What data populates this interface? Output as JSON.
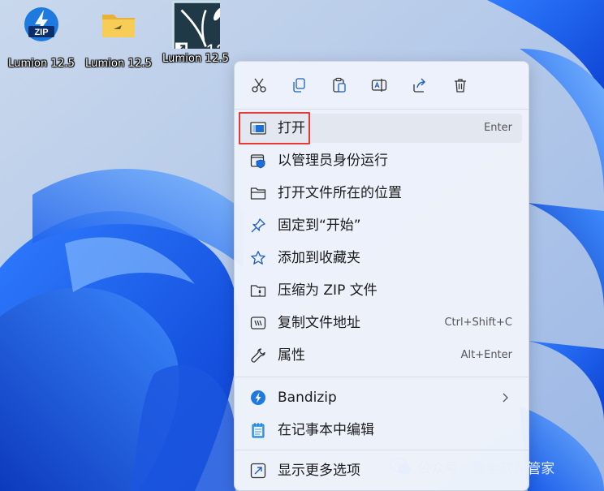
{
  "desktop": {
    "icons": [
      {
        "label": "Lumion 12.5",
        "icon": "zip-archive-icon"
      },
      {
        "label": "Lumion 12.5",
        "icon": "folder-icon"
      },
      {
        "label": "Lumion 12.5",
        "icon": "lumion-shortcut-icon"
      }
    ]
  },
  "context_menu": {
    "toolbar": [
      "cut-icon",
      "copy-icon",
      "paste-icon",
      "rename-icon",
      "share-icon",
      "delete-icon"
    ],
    "items": [
      {
        "label": "打开",
        "shortcut": "Enter",
        "icon": "app-window-icon",
        "highlighted": true
      },
      {
        "label": "以管理员身份运行",
        "shortcut": "",
        "icon": "admin-shield-icon"
      },
      {
        "label": "打开文件所在的位置",
        "shortcut": "",
        "icon": "folder-outline-icon"
      },
      {
        "label": "固定到“开始”",
        "shortcut": "",
        "icon": "pin-icon"
      },
      {
        "label": "添加到收藏夹",
        "shortcut": "",
        "icon": "star-icon"
      },
      {
        "label": "压缩为 ZIP 文件",
        "shortcut": "",
        "icon": "zip-folder-icon"
      },
      {
        "label": "复制文件地址",
        "shortcut": "Ctrl+Shift+C",
        "icon": "copy-path-icon"
      },
      {
        "label": "属性",
        "shortcut": "Alt+Enter",
        "icon": "wrench-icon"
      },
      {
        "label": "Bandizip",
        "shortcut": "",
        "icon": "bandizip-icon",
        "submenu": true
      },
      {
        "label": "在记事本中编辑",
        "shortcut": "",
        "icon": "notepad-icon"
      },
      {
        "label": "显示更多选项",
        "shortcut": "",
        "icon": "more-options-icon"
      }
    ]
  },
  "watermark": {
    "text": "公众号 · 最全软件管家"
  },
  "colors": {
    "highlight_border": "#e53935",
    "accent": "#0067c0"
  }
}
